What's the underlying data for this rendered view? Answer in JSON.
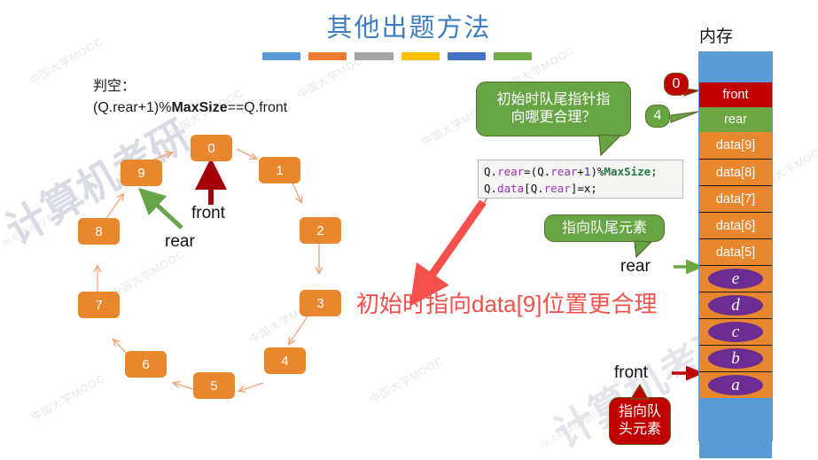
{
  "title": "其他出题方法",
  "title_bar_colors": [
    "#5B9BD5",
    "#ED7D31",
    "#A5A5A5",
    "#FFC000",
    "#4472C4",
    "#70AD47"
  ],
  "left_note": {
    "line1": "判空：",
    "line2_pre": "(Q.rear+1)%",
    "line2_bold": "MaxSize",
    "line2_post": "==Q.front"
  },
  "circle": {
    "boxes": [
      "0",
      "1",
      "2",
      "3",
      "4",
      "5",
      "6",
      "7",
      "8",
      "9"
    ],
    "front_label": "front",
    "rear_label": "rear",
    "front_arrow_color": "#A5000A",
    "rear_arrow_color": "#68A548",
    "box_color": "#E8872E"
  },
  "question_bubble": {
    "line1": "初始时队尾指针指",
    "line2": "向哪更合理？",
    "color": "#67A444"
  },
  "code": {
    "line1": {
      "t1": "Q.",
      "t2": "rear",
      "t3": "=(Q.",
      "t4": "rear",
      "t5": "+",
      "t6": "1",
      "t7": ")%",
      "t8": "MaxSize",
      "t9": ";"
    },
    "line2": {
      "t1": "Q.",
      "t2": "data",
      "t3": "[Q.",
      "t4": "rear",
      "t5": "]=x;"
    }
  },
  "emphasis_text": "初始时指向data[9]位置更合理",
  "emphasis_color": "#F4504C",
  "rear_bubble": {
    "text": "指向队尾元素",
    "color": "#67A444"
  },
  "front_bubble": {
    "line1": "指向队",
    "line2": "头元素",
    "color": "#C00000"
  },
  "memory": {
    "title": "内存",
    "front_value_badge": "0",
    "rear_value_badge": "4",
    "front_badge_color": "#C00000",
    "rear_badge_color": "#6EA644",
    "cells": [
      {
        "label": "",
        "kind": "blue",
        "h": 34
      },
      {
        "label": "front",
        "kind": "red",
        "h": 28
      },
      {
        "label": "rear",
        "kind": "green",
        "h": 28
      },
      {
        "label": "data[9]",
        "kind": "orange",
        "h": 30
      },
      {
        "label": "data[8]",
        "kind": "orange",
        "h": 30
      },
      {
        "label": "data[7]",
        "kind": "orange",
        "h": 30
      },
      {
        "label": "data[6]",
        "kind": "orange",
        "h": 30
      },
      {
        "label": "data[5]",
        "kind": "orange",
        "h": 30
      },
      {
        "label": "e",
        "kind": "oval",
        "h": 30
      },
      {
        "label": "d",
        "kind": "oval",
        "h": 30
      },
      {
        "label": "c",
        "kind": "oval",
        "h": 30
      },
      {
        "label": "b",
        "kind": "oval",
        "h": 30
      },
      {
        "label": "a",
        "kind": "oval",
        "h": 30
      },
      {
        "label": "",
        "kind": "blue",
        "h": 68
      }
    ],
    "rear_pointer_label": "rear",
    "front_pointer_label": "front",
    "rear_pointer_color": "#6EA644",
    "front_pointer_color": "#C00000"
  },
  "watermarks": {
    "big_left": "计算机考研",
    "small": "中国大学MOOC",
    "site": "w.cskaoyan.com"
  }
}
